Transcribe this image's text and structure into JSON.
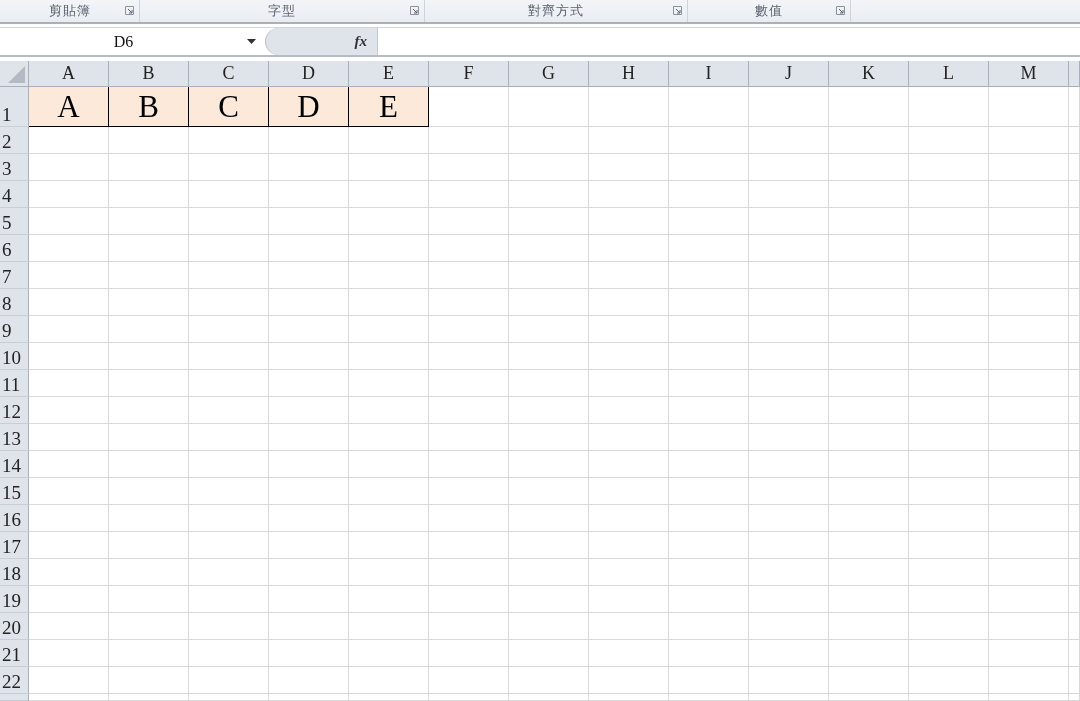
{
  "ribbon_groups": [
    {
      "label": "剪貼簿"
    },
    {
      "label": "字型"
    },
    {
      "label": "對齊方式"
    },
    {
      "label": "數值"
    }
  ],
  "formula_bar": {
    "name_box": "D6",
    "function_button": "fx"
  },
  "columns": [
    "A",
    "B",
    "C",
    "D",
    "E",
    "F",
    "G",
    "H",
    "I",
    "J",
    "K",
    "L",
    "M"
  ],
  "rows": [
    {
      "header": "1",
      "cells": [
        {
          "value": "A",
          "filled": true
        },
        {
          "value": "B",
          "filled": true
        },
        {
          "value": "C",
          "filled": true
        },
        {
          "value": "D",
          "filled": true
        },
        {
          "value": "E",
          "filled": true
        }
      ]
    },
    {
      "header": "2"
    },
    {
      "header": "3"
    },
    {
      "header": "4"
    },
    {
      "header": "5"
    },
    {
      "header": "6"
    },
    {
      "header": "7"
    },
    {
      "header": "8"
    },
    {
      "header": "9"
    },
    {
      "header": "10"
    },
    {
      "header": "11"
    },
    {
      "header": "12"
    },
    {
      "header": "13"
    },
    {
      "header": "14"
    },
    {
      "header": "15"
    },
    {
      "header": "16"
    },
    {
      "header": "17"
    },
    {
      "header": "18"
    },
    {
      "header": "19"
    },
    {
      "header": "20"
    },
    {
      "header": "21"
    },
    {
      "header": "22"
    }
  ]
}
